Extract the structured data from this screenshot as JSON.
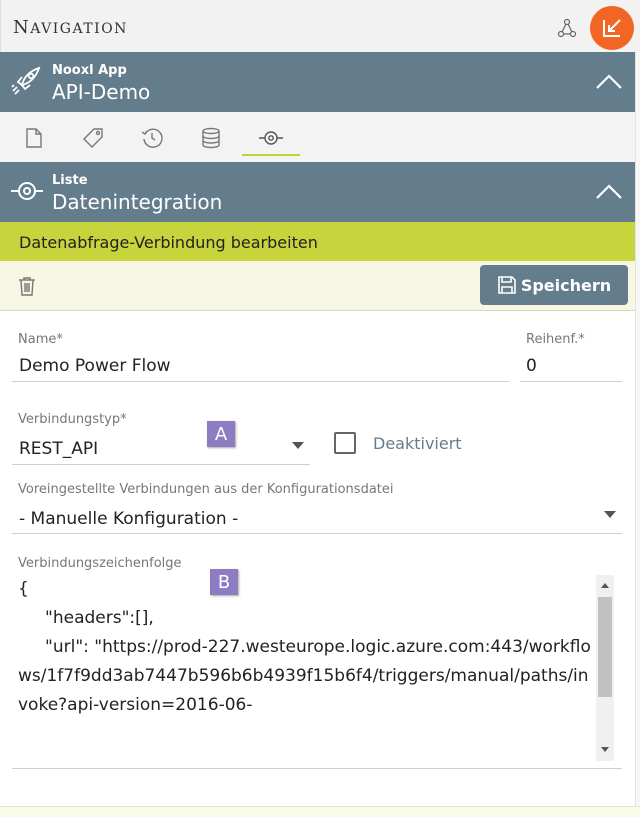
{
  "nav": {
    "title_first": "N",
    "title_rest": "AVIGATION"
  },
  "app": {
    "sub": "Nooxl App",
    "title": "API-Demo"
  },
  "list": {
    "sub": "Liste",
    "title": "Datenintegration"
  },
  "form": {
    "title": "Datenabfrage-Verbindung bearbeiten",
    "save_label": "Speichern"
  },
  "fields": {
    "name": {
      "label": "Name*",
      "value": "Demo Power Flow"
    },
    "order": {
      "label": "Reihenf.*",
      "value": "0"
    },
    "connection_type": {
      "label": "Verbindungstyp*",
      "value": "REST_API"
    },
    "disabled": {
      "label": "Deaktiviert",
      "checked": false
    },
    "preset": {
      "label": "Voreingestellte Verbindungen aus der Konfigurationsdatei",
      "value": "- Manuelle Konfiguration -"
    },
    "connection_string": {
      "label": "Verbindungszeichenfolge",
      "value": "{\n     \"headers\":[],\n     \"url\": \"https://prod-227.westeurope.logic.azure.com:443/workflows/1f7f9dd3ab7447b596b6b4939f15b6f4/triggers/manual/paths/invoke?api-version=2016-06-"
    }
  },
  "markers": {
    "a": "A",
    "b": "B"
  },
  "icons": {
    "tabs": [
      "document-icon",
      "tag-icon",
      "history-icon",
      "database-icon",
      "integration-icon"
    ],
    "app": "rocket-icon",
    "list": "integration-icon"
  },
  "colors": {
    "bar": "#647d8c",
    "accent": "#c7d43c",
    "orange": "#f26522",
    "marker": "#8e7cc3"
  }
}
